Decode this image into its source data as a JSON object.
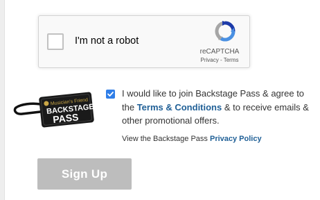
{
  "recaptcha": {
    "checkbox_label": "I'm not a robot",
    "brand": "reCAPTCHA",
    "privacy_link": "Privacy",
    "separator": " - ",
    "terms_link": "Terms",
    "checked": false,
    "icon": "recaptcha-logo-icon"
  },
  "backstage_logo": {
    "line1": "Musician's Friend",
    "line2": "BACKSTAGE",
    "line3": "PASS",
    "icon": "backstage-pass-tag-icon"
  },
  "optin": {
    "checked": true,
    "text_before": "I would like to join Backstage Pass & agree to the ",
    "terms_link": "Terms & Conditions",
    "text_after": " & to receive emails & other promotional offers."
  },
  "privacy": {
    "text": "View the Backstage Pass ",
    "link": "Privacy Policy"
  },
  "signup": {
    "label": "Sign Up"
  },
  "colors": {
    "link": "#1f5f96",
    "checkbox_checked": "#2f7ee8",
    "button_disabled": "#bdbdbd"
  }
}
